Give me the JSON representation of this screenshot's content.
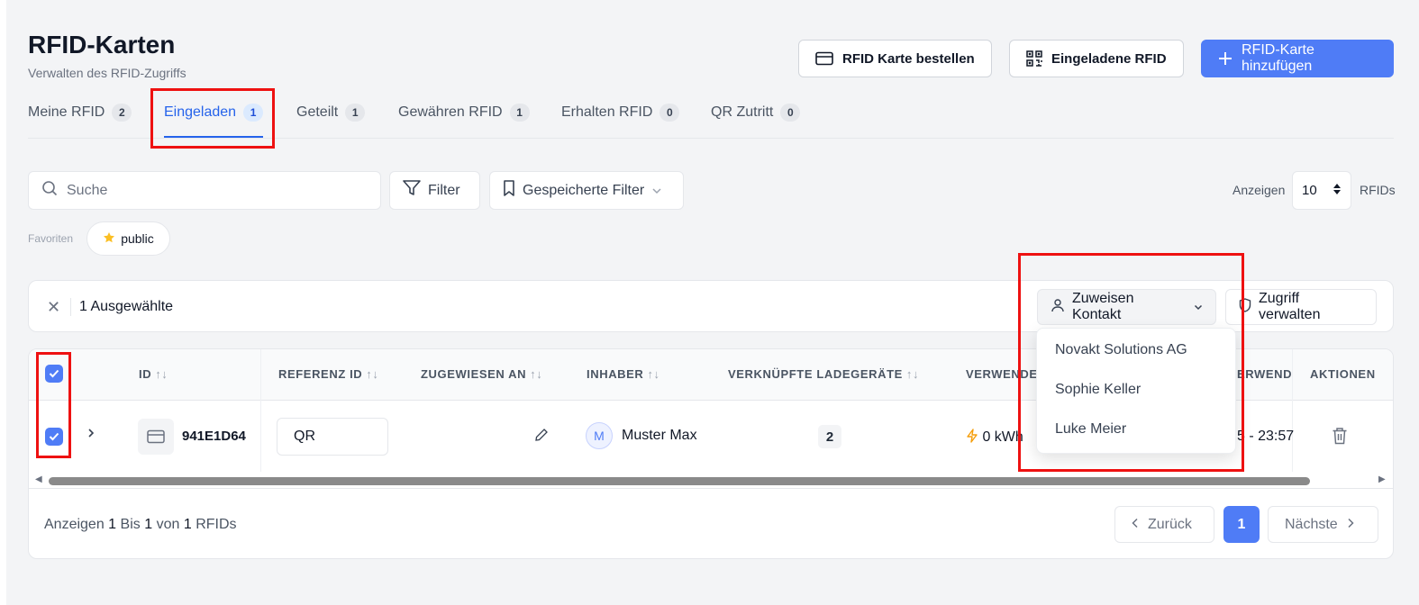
{
  "header": {
    "title": "RFID-Karten",
    "subtitle": "Verwalten des RFID-Zugriffs",
    "btn_order": "RFID Karte bestellen",
    "btn_invited": "Eingeladene RFID",
    "btn_add": "RFID-Karte hinzufügen"
  },
  "tabs": [
    {
      "label": "Meine RFID",
      "count": "2"
    },
    {
      "label": "Eingeladen",
      "count": "1"
    },
    {
      "label": "Geteilt",
      "count": "1"
    },
    {
      "label": "Gewähren RFID",
      "count": "1"
    },
    {
      "label": "Erhalten RFID",
      "count": "0"
    },
    {
      "label": "QR Zutritt",
      "count": "0"
    }
  ],
  "toolbar": {
    "search_placeholder": "Suche",
    "filter_label": "Filter",
    "saved_filters_label": "Gespeicherte Filter",
    "show_label": "Anzeigen",
    "show_value": "10",
    "show_unit": "RFIDs"
  },
  "favorites": {
    "label": "Favoriten",
    "chip": "public"
  },
  "selection": {
    "count_text": "1 Ausgewählte",
    "assign_contact": "Zuweisen Kontakt",
    "manage_access": "Zugriff verwalten"
  },
  "table": {
    "columns": {
      "id": "ID",
      "reference": "REFERENZ ID",
      "assigned_to": "ZUGEWIESEN AN",
      "owner": "INHABER",
      "chargers": "VERKNÜPFTE LADEGERÄTE",
      "used": "VERWENDE",
      "used2": "ERWEND",
      "actions": "AKTIONEN"
    },
    "rows": [
      {
        "id": "941E1D64",
        "reference": "QR",
        "owner_initial": "M",
        "owner": "Muster Max",
        "chargers": "2",
        "energy": "0 kWh",
        "time": "5 - 23:57"
      }
    ]
  },
  "footer": {
    "show": "Anzeigen",
    "from": "1",
    "to_word": "Bis",
    "to": "1",
    "of_word": "von",
    "total": "1",
    "unit": "RFIDs",
    "prev": "Zurück",
    "page": "1",
    "next": "Nächste"
  },
  "dropdown": {
    "items": [
      "Novakt Solutions AG",
      "Sophie Keller",
      "Luke Meier"
    ]
  },
  "colors": {
    "primary": "#4f7cf6",
    "active_tab": "#2563eb",
    "annotation": "#ee1111",
    "energy_icon": "#f59e0b"
  }
}
